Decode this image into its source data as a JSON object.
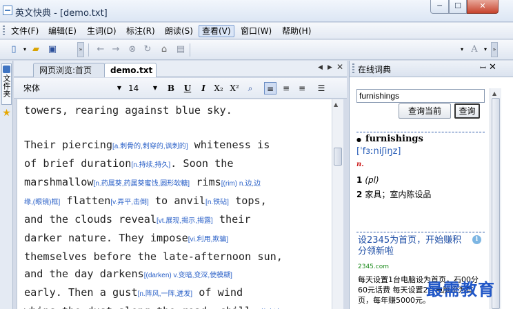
{
  "window": {
    "title": "英文快典 - [demo.txt]",
    "controls": {
      "minimize": "─",
      "maximize": "☐",
      "close": "✕"
    }
  },
  "menu": [
    {
      "label": "文件(F)"
    },
    {
      "label": "编辑(E)"
    },
    {
      "label": "生词(D)"
    },
    {
      "label": "标注(R)"
    },
    {
      "label": "朗读(S)"
    },
    {
      "label": "查看(V)",
      "active": true
    },
    {
      "label": "窗口(W)"
    },
    {
      "label": "帮助(H)"
    }
  ],
  "left_panel": {
    "tab_label": "文件夹"
  },
  "document": {
    "tabs": [
      {
        "label": "网页浏览:首页"
      },
      {
        "label": "demo.txt",
        "active": true
      }
    ],
    "font_name": "宋体",
    "font_size": "14",
    "format_buttons": {
      "bold": "B",
      "underline": "U",
      "italic": "I",
      "subscript": "X₂",
      "superscript": "X²"
    },
    "lines": [
      {
        "parts": [
          {
            "t": "towers, rearing against blue sky."
          }
        ]
      },
      {
        "gap": true
      },
      {
        "parts": [
          {
            "t": "Their piercing"
          },
          {
            "a": "[a.刺骨的,刺穿的,讽刺的]"
          },
          {
            "t": " whiteness is"
          }
        ]
      },
      {
        "parts": [
          {
            "t": "of brief duration"
          },
          {
            "a": "[n.持续,持久]"
          },
          {
            "t": ". Soon the"
          }
        ]
      },
      {
        "parts": [
          {
            "t": "marshmallow"
          },
          {
            "a": "[n.药属葵,药属葵蜜饯,圆形软糖]"
          },
          {
            "t": " rims"
          },
          {
            "a": "[(rim) n.边,边"
          }
        ]
      },
      {
        "parts": [
          {
            "a": "缘,(眼镜)框]"
          },
          {
            "t": " flatten"
          },
          {
            "a": "[v.弄平,击倒]"
          },
          {
            "t": " to anvil"
          },
          {
            "a": "[n.铁砧]"
          },
          {
            "t": " tops,"
          }
        ]
      },
      {
        "parts": [
          {
            "t": "and the clouds reveal"
          },
          {
            "a": "[vt.展现,揭示,揭露]"
          },
          {
            "t": " their"
          }
        ]
      },
      {
        "parts": [
          {
            "t": "darker nature. They impose"
          },
          {
            "a": "[vi.利用,欺骗]"
          }
        ]
      },
      {
        "parts": [
          {
            "t": "themselves before the late-afternoon sun,"
          }
        ]
      },
      {
        "parts": [
          {
            "t": "and the day darkens"
          },
          {
            "a": "[(darken) v.变暗,变深,使模糊]"
          }
        ]
      },
      {
        "parts": [
          {
            "t": "early. Then a gust"
          },
          {
            "a": "[n.阵风,一阵,迸发]"
          },
          {
            "t": " of wind"
          }
        ]
      },
      {
        "parts": [
          {
            "t": "whips the dust along the road, chill"
          },
          {
            "a": "[vt.使变冷"
          }
        ]
      }
    ]
  },
  "dictionary": {
    "panel_title": "在线词典",
    "pin": "ꟷ",
    "close": "✕",
    "query": "furnishings",
    "btn_current": "查询当前",
    "btn_query": "查询",
    "headword": "furnishings",
    "bullet": "●",
    "phonetic": "[ˈfɜːniʃiŋz]",
    "pos_mark": "n.",
    "senses": [
      {
        "num": "1",
        "text": "(pl)"
      },
      {
        "num": "2",
        "text": "家具；室内陈设品"
      }
    ],
    "ad": {
      "title": "设2345为首页，开始赚积分领新啦",
      "info": "i",
      "host": "2345.com",
      "body": "每天设置1台电脑设为首页，石00分60元话费 每天设置2台电脑设为首页，每年赚5000元。"
    }
  },
  "watermark": "最需教育"
}
